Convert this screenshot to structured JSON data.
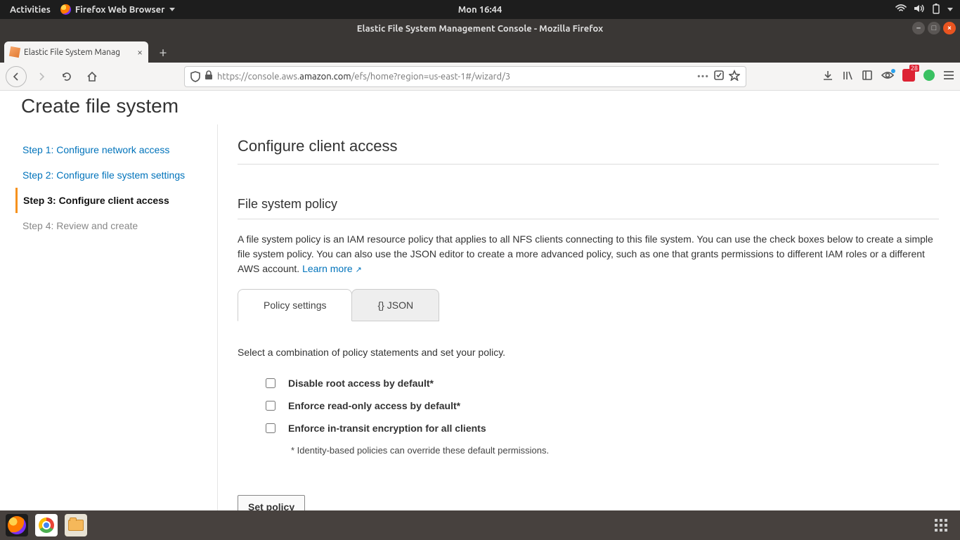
{
  "gnome": {
    "activities": "Activities",
    "app_name": "Firefox Web Browser",
    "clock": "Mon 16:44"
  },
  "firefox": {
    "window_title": "Elastic File System Management Console - Mozilla Firefox",
    "tab_title": "Elastic File System Manag",
    "url_prefix": "https://console.aws.",
    "url_host_main": "amazon.com",
    "url_path": "/efs/home?region=us-east-1#/wizard/3",
    "badge_count": "28"
  },
  "page": {
    "title": "Create file system",
    "steps": [
      "Step 1: Configure network access",
      "Step 2: Configure file system settings",
      "Step 3: Configure client access",
      "Step 4: Review and create"
    ],
    "section_heading": "Configure client access",
    "subsection_heading": "File system policy",
    "description": "A file system policy is an IAM resource policy that applies to all NFS clients connecting to this file system. You can use the check boxes below to create a simple file system policy. You can also use the JSON editor to create a more advanced policy, such as one that grants permissions to different IAM roles or a different AWS account. ",
    "learn_more": "Learn more",
    "tabs": {
      "policy_settings": "Policy settings",
      "json": "{} JSON"
    },
    "combo_hint": "Select a combination of policy statements and set your policy.",
    "checks": {
      "disable_root": "Disable root access by default*",
      "read_only": "Enforce read-only access by default*",
      "in_transit": "Enforce in-transit encryption for all clients"
    },
    "note": "* Identity-based policies can override these default permissions.",
    "set_policy_btn": "Set policy"
  }
}
